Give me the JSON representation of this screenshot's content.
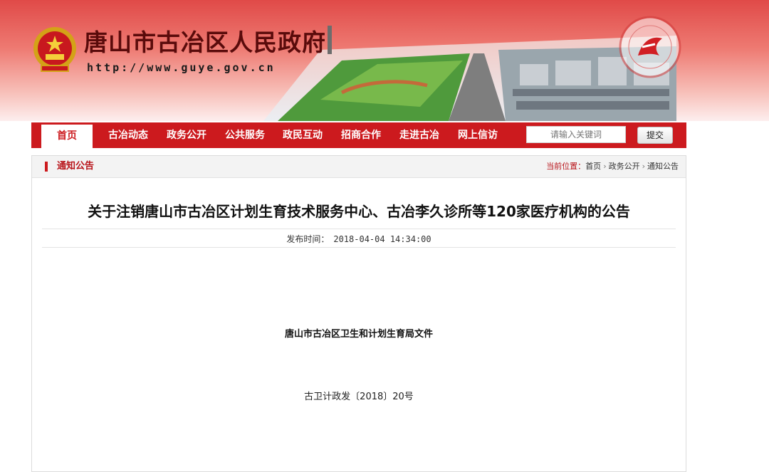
{
  "header": {
    "site_title": "唐山市古冶区人民政府",
    "site_url": "http://www.guye.gov.cn",
    "emblem_icon": "national-emblem-icon",
    "seal_icon": "tangshan-government-portal-seal-icon"
  },
  "nav": {
    "items": [
      {
        "label": "首页"
      },
      {
        "label": "古冶动态"
      },
      {
        "label": "政务公开"
      },
      {
        "label": "公共服务"
      },
      {
        "label": "政民互动"
      },
      {
        "label": "招商合作"
      },
      {
        "label": "走进古冶"
      },
      {
        "label": "网上信访"
      }
    ],
    "search_placeholder": "请输入关键词",
    "submit_label": "提交"
  },
  "section": {
    "title": "通知公告",
    "breadcrumb_label": "当前位置：",
    "breadcrumb": [
      "首页",
      "政务公开",
      "通知公告"
    ]
  },
  "article": {
    "title": "关于注销唐山市古冶区计划生育技术服务中心、古冶李久诊所等120家医疗机构的公告",
    "publish_label": "发布时间：",
    "publish_time": "2018-04-04 14:34:00",
    "issuer": "唐山市古冶区卫生和计划生育局文件",
    "doc_number": "古卫计政发〔2018〕20号"
  },
  "colors": {
    "nav_red": "#cc1a1e",
    "title_dark_red": "#5a0b0b"
  }
}
